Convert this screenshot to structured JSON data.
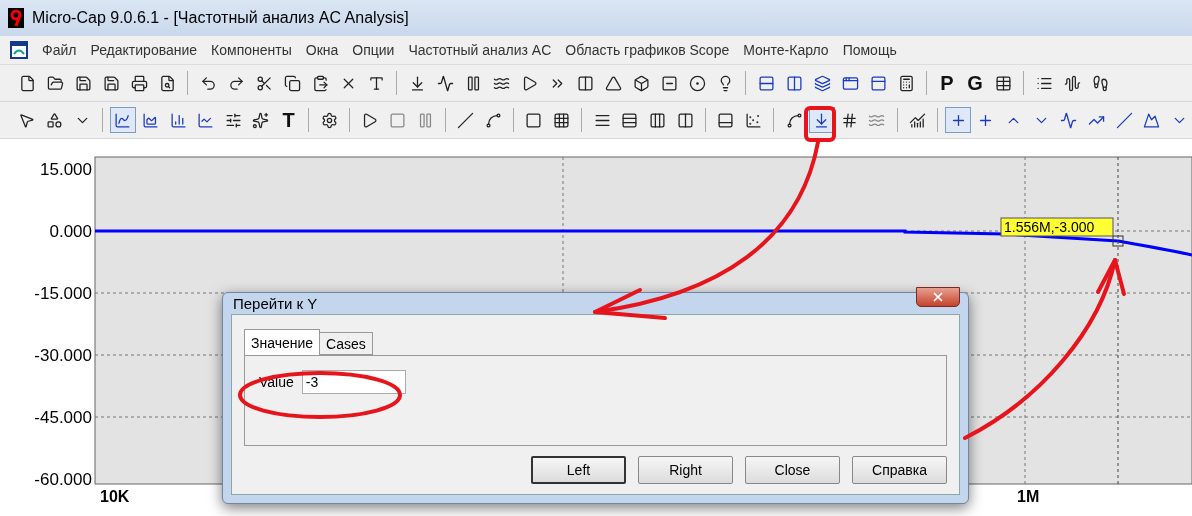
{
  "window": {
    "title": "Micro-Cap 9.0.6.1 - [Частотный анализ AC Analysis]"
  },
  "menu": [
    "Файл",
    "Редактирование",
    "Компоненты",
    "Окна",
    "Опции",
    "Частотный анализ AC",
    "Область графиков Scope",
    "Монте-Карло",
    "Помощь"
  ],
  "toolbar_1": {
    "letters": [
      "P",
      "G"
    ]
  },
  "toolbar_2": {
    "letters": [
      "T"
    ]
  },
  "plot": {
    "y_axis_labels": [
      "15.000",
      "0.000",
      "-15.000",
      "-30.000",
      "-45.000",
      "-60.000"
    ],
    "x_axis_labels": [
      "10K",
      "1M"
    ],
    "cursor_readout": "1.556M,-3.000"
  },
  "dialog": {
    "title": "Перейти к Y",
    "tabs": [
      {
        "label": "Значение",
        "selected": true
      },
      {
        "label": "Cases",
        "selected": false
      }
    ],
    "value_field": {
      "label": "Value",
      "value": "-3"
    },
    "buttons": [
      {
        "label": "Left",
        "default": true
      },
      {
        "label": "Right",
        "default": false
      },
      {
        "label": "Close",
        "default": false
      },
      {
        "label": "Справка",
        "default": false
      }
    ]
  }
}
